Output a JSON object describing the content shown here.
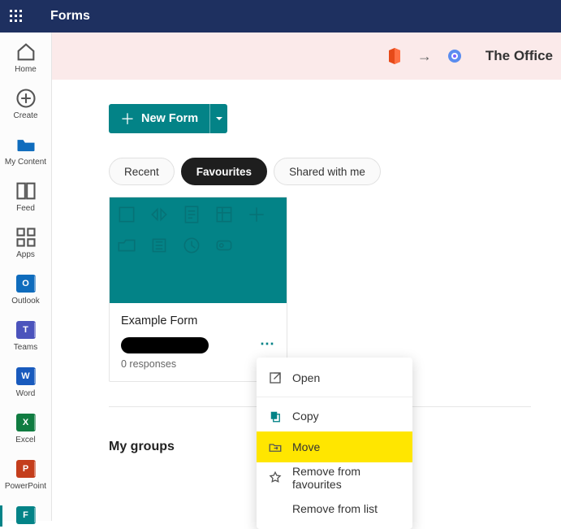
{
  "topbar": {
    "app_title": "Forms"
  },
  "banner": {
    "text": "The Office"
  },
  "sidebar": {
    "items": [
      {
        "label": "Home"
      },
      {
        "label": "Create"
      },
      {
        "label": "My Content"
      },
      {
        "label": "Feed"
      },
      {
        "label": "Apps"
      },
      {
        "label": "Outlook"
      },
      {
        "label": "Teams"
      },
      {
        "label": "Word"
      },
      {
        "label": "Excel"
      },
      {
        "label": "PowerPoint"
      }
    ]
  },
  "main": {
    "new_form_label": "New Form",
    "filters": {
      "recent": "Recent",
      "favourites": "Favourites",
      "shared": "Shared with me"
    },
    "card": {
      "title": "Example Form",
      "responses": "0 responses"
    },
    "groups_heading": "My groups"
  },
  "context_menu": {
    "open": "Open",
    "copy": "Copy",
    "move": "Move",
    "remove_fav": "Remove from favourites",
    "remove_list": "Remove from list"
  }
}
